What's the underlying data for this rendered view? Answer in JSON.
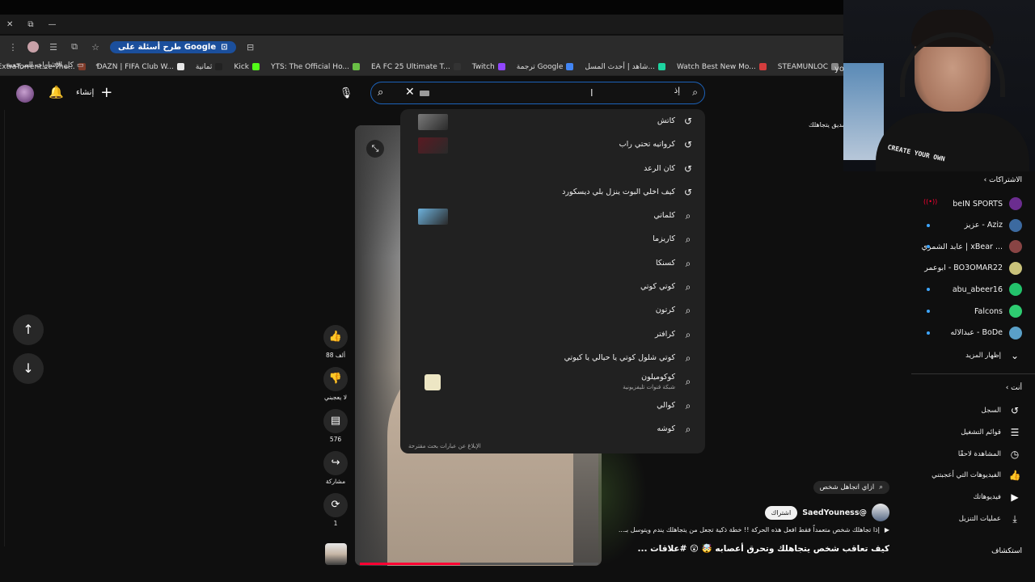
{
  "browser": {
    "window_close_glyph": "✕",
    "window_restore_glyph": "⧉",
    "window_min_glyph": "—",
    "google_chip_label": "طرح أسئلة على Google",
    "bookmarks_all_label": "كل الإشارات المرجعية",
    "bookmarks_more_glyph": "«",
    "bookmarks": [
      {
        "label": "ExtraTorrent.cc The...",
        "color": "#7f3b2a"
      },
      {
        "label": "DAZN | FIFA Club W...",
        "color": "#e8e8e8"
      },
      {
        "label": "ثمانية",
        "color": "#222222"
      },
      {
        "label": "Kick",
        "color": "#53fc18"
      },
      {
        "label": "YTS: The Official Ho...",
        "color": "#6ac045"
      },
      {
        "label": "EA FC 25 Ultimate T...",
        "color": "#333333"
      },
      {
        "label": "Twitch",
        "color": "#9146ff"
      },
      {
        "label": "ترجمة Google",
        "color": "#4285f4"
      },
      {
        "label": "شاهد | أحدث المسل...",
        "color": "#1dd4a0"
      },
      {
        "label": "Watch Best New Mo...",
        "color": "#d33d3d"
      },
      {
        "label": "STEAMUNLOC",
        "color": "#888888"
      }
    ]
  },
  "header": {
    "create_label": "إنشاء",
    "search_value": "",
    "search_kbd_label": "إذ",
    "mic_glyph": "🎙",
    "bell_glyph": "🔔",
    "search_glyph": "⌕",
    "clear_glyph": "✕"
  },
  "suggestions": [
    {
      "text": "كاتش",
      "kind": "history",
      "thumb": "#7a7a7a"
    },
    {
      "text": "كرواتيه تحتي راب",
      "kind": "history",
      "thumb": "#5a1a22"
    },
    {
      "text": "كان الرعد",
      "kind": "history",
      "thumb": ""
    },
    {
      "text": "كيف اخلي البوت ينزل بلي ديسكورد",
      "kind": "history",
      "thumb": ""
    },
    {
      "text": "كلماتي",
      "kind": "search",
      "thumb": "#6db2dc"
    },
    {
      "text": "كاريزما",
      "kind": "search",
      "thumb": ""
    },
    {
      "text": "كسنكا",
      "kind": "search",
      "thumb": ""
    },
    {
      "text": "كوتي كوتي",
      "kind": "search",
      "thumb": ""
    },
    {
      "text": "كرتون",
      "kind": "search",
      "thumb": ""
    },
    {
      "text": "كرافتر",
      "kind": "search",
      "thumb": ""
    },
    {
      "text": "كوتي شلول كوتي يا حيالي يا كيوتي",
      "kind": "search",
      "thumb": ""
    },
    {
      "text": "كوكوميلون",
      "sub": "شبكة قنوات تليفزيونية",
      "kind": "search",
      "thumb": "small"
    },
    {
      "text": "كوالي",
      "kind": "search",
      "thumb": ""
    },
    {
      "text": "كوشه",
      "kind": "search",
      "thumb": ""
    }
  ],
  "dropdown_report": "الإبلاغ عن عبارات بحث مقترحة",
  "nav": {
    "up_glyph": "↑",
    "down_glyph": "↓"
  },
  "actions": {
    "like_count": "88 ألف",
    "dislike_label": "لا يعجبني",
    "comments_count": "576",
    "share_label": "مشاركة",
    "remix_count": "1"
  },
  "video": {
    "progress": 0.42,
    "search_chip": "ازاي اتجاهل شخص",
    "channel": "@SaedYouness",
    "subscribe": "اشتراك",
    "description": "إذا تجاهلك شخص متعمداً فقط افعل هذه الحركة !! خطة ذكية تجعل من يتجاهلك يندم ويتوسل بـ...",
    "title": "كيف تعاقب شخص يتجاهلك وتحرق أعصابه 🤯 😲 #علاقات ...",
    "side_caption": "صديق يتجاهلك"
  },
  "sidebar": {
    "subscriptions_header": "الاشتراكات",
    "subscriptions": [
      {
        "name": "beIN SPORTS",
        "color": "#6b2d8f",
        "live": true,
        "dot": false
      },
      {
        "name": "عزيز - Aziz",
        "color": "#3c6aa0",
        "live": false,
        "dot": true
      },
      {
        "name": "عابد الشمري | xBear ...",
        "color": "#884444",
        "live": false,
        "dot": true
      },
      {
        "name": "ابوعمر - BO3OMAR22",
        "color": "#c9c27a",
        "live": false,
        "dot": false
      },
      {
        "name": "abu_abeer16",
        "color": "#23c26b",
        "live": false,
        "dot": true
      },
      {
        "name": "Falcons",
        "color": "#2ecc71",
        "live": false,
        "dot": true
      },
      {
        "name": "عبدالاله - BoDe",
        "color": "#5aa0c8",
        "live": false,
        "dot": true
      }
    ],
    "show_more": "إظهار المزيد",
    "you_header": "أنت",
    "you_items": [
      {
        "label": "السجل",
        "icon": "history-icon",
        "glyph": "↺"
      },
      {
        "label": "قوائم التشغيل",
        "icon": "playlist-icon",
        "glyph": "☰"
      },
      {
        "label": "المشاهدة لاحقًا",
        "icon": "clock-icon",
        "glyph": "◷"
      },
      {
        "label": "الفيديوهات التي أعجبتني",
        "icon": "like-icon",
        "glyph": "👍"
      },
      {
        "label": "فيديوهاتك",
        "icon": "video-icon",
        "glyph": "▶"
      },
      {
        "label": "عمليات التنزيل",
        "icon": "download-icon",
        "glyph": "⤓"
      }
    ],
    "explore_header": "استكشاف"
  },
  "webcam": {
    "shirt_text": "CREATE YOUR OWN",
    "top_text": "yo"
  },
  "colors": {
    "accent": "#3ea6ff",
    "brand": "#ff0033",
    "search_border": "#1c62b9"
  }
}
